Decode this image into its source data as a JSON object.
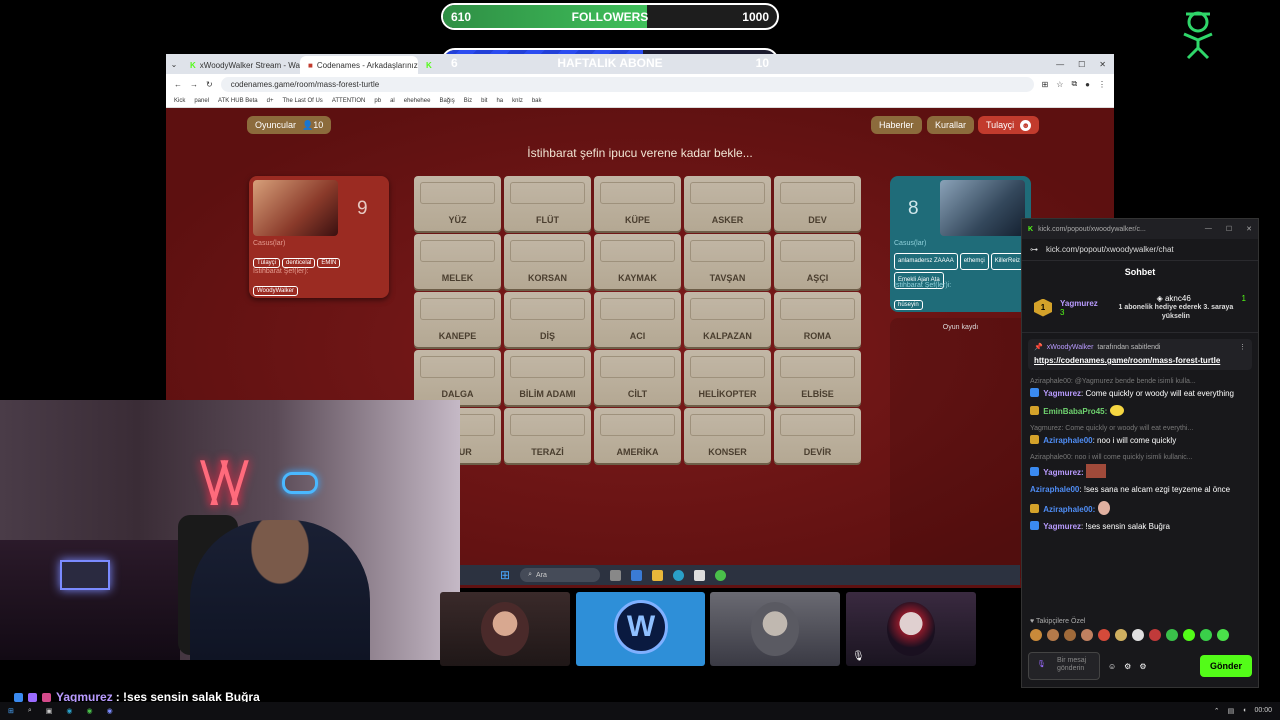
{
  "overlay": {
    "followers": {
      "current": "610",
      "label": "FOLLOWERS",
      "goal": "1000",
      "progress": 0.61
    },
    "abone": {
      "current": "6",
      "label": "HAFTALIK ABONE",
      "goal": "10",
      "progress": 0.6
    }
  },
  "browser": {
    "tabs": [
      {
        "title": "xWoodyWalker Stream - Watch"
      },
      {
        "title": "Codenames - Arkadaşlarınızla ç"
      },
      {
        "title": ""
      }
    ],
    "url": "codenames.game/room/mass-forest-turtle",
    "bookmarks": [
      "Kick",
      "panel",
      "ATK HUB Beta",
      "d+",
      "The Last Of Us",
      "ATTENTION",
      "pb",
      "al",
      "ehehehee",
      "Bağış",
      "Biz",
      "bit",
      "ha",
      "knlz",
      "bak"
    ]
  },
  "game": {
    "players_button": "Oyuncular",
    "players_count": "10",
    "news_button": "Haberler",
    "rules_button": "Kurallar",
    "user_button": "Tulayçi",
    "headline": "İstihbarat şefin ipucu verene kadar bekle...",
    "red_team": {
      "score": "9",
      "spies_label": "Casus(lar)",
      "spies": [
        "Tülayçi",
        "denticelal",
        "EMİN"
      ],
      "chiefs_label": "İstihbarat Şef(ler):",
      "chiefs": [
        "WoodyWalker"
      ]
    },
    "blue_team": {
      "score": "8",
      "spies_label": "Casus(lar)",
      "spies": [
        "anlamadersz ZAAAA",
        "ethemçi",
        "KillerReiz",
        "Emekli Ajan Ata"
      ],
      "chiefs_label": "İstihbarat Şef(ler)i:",
      "chiefs": [
        "hüseyin"
      ]
    },
    "log_title": "Oyun kaydı",
    "cards": [
      "YÜZ",
      "FLÜT",
      "KÜPE",
      "ASKER",
      "DEV",
      "MELEK",
      "KORSAN",
      "KAYMAK",
      "TAVŞAN",
      "AŞÇI",
      "KANEPE",
      "DİŞ",
      "ACI",
      "KALPAZAN",
      "ROMA",
      "DALGA",
      "BİLİM ADAMI",
      "CİLT",
      "HELİKOPTER",
      "ELBİSE",
      "…AUR",
      "TERAZİ",
      "AMERİKA",
      "KONSER",
      "DEVİR"
    ]
  },
  "inner_taskbar": {
    "search_placeholder": "Ara"
  },
  "chat": {
    "window_title": "kick.com/popout/xwoodywalker/c...",
    "url": "kick.com/popout/xwoodywalker/chat",
    "header": "Sohbet",
    "gift": {
      "user": "Yagmurez",
      "count": "3",
      "giver": "aknc46",
      "giver_count": "1",
      "message": "1 abonelik hediye ederek 3. saraya yükselin"
    },
    "pinned": {
      "by": "xWoodyWalker",
      "suffix": "tarafından sabitlendi",
      "link": "https://codenames.game/room/mass-forest-turtle"
    },
    "messages": [
      {
        "reply": "Aziraphale00: @Yagmurez bende bende isimli kulla...",
        "user": "Yagmurez",
        "text": "Come quickly or woody will eat everything",
        "color": "yag"
      },
      {
        "reply": "",
        "user": "EminBabaPro45:",
        "text": "",
        "color": "emi"
      },
      {
        "reply": "Yagmurez: Come quickly or woody will eat everythi...",
        "user": "Aziraphale00",
        "text": "noo i will come quickly",
        "color": "azi"
      },
      {
        "reply": "Aziraphale00: noo i will come quickly isimli kullanic...",
        "user": "Yagmurez:",
        "text": "",
        "color": "yag"
      },
      {
        "reply": "",
        "user": "Aziraphale00",
        "text": "!ses sana ne alcam ezgi teyzeme al önce",
        "color": "azi"
      },
      {
        "reply": "",
        "user": "Aziraphale00:",
        "text": "",
        "color": "azi"
      },
      {
        "reply": "",
        "user": "Yagmurez",
        "text": "!ses sensin salak Buğra",
        "color": "yag"
      }
    ],
    "emotes_label": "Takipçilere Özel",
    "input_placeholder": "Bir mesaj gönderin",
    "send_label": "Gönder"
  },
  "banner": {
    "user": "Yagmurez",
    "text": ": !ses sensin salak Buğra"
  },
  "taskbar": {
    "time": "00:00"
  },
  "colors": {
    "kick_green": "#53fc18",
    "red_team": "#9b2b22",
    "blue_team": "#1f6c79"
  }
}
